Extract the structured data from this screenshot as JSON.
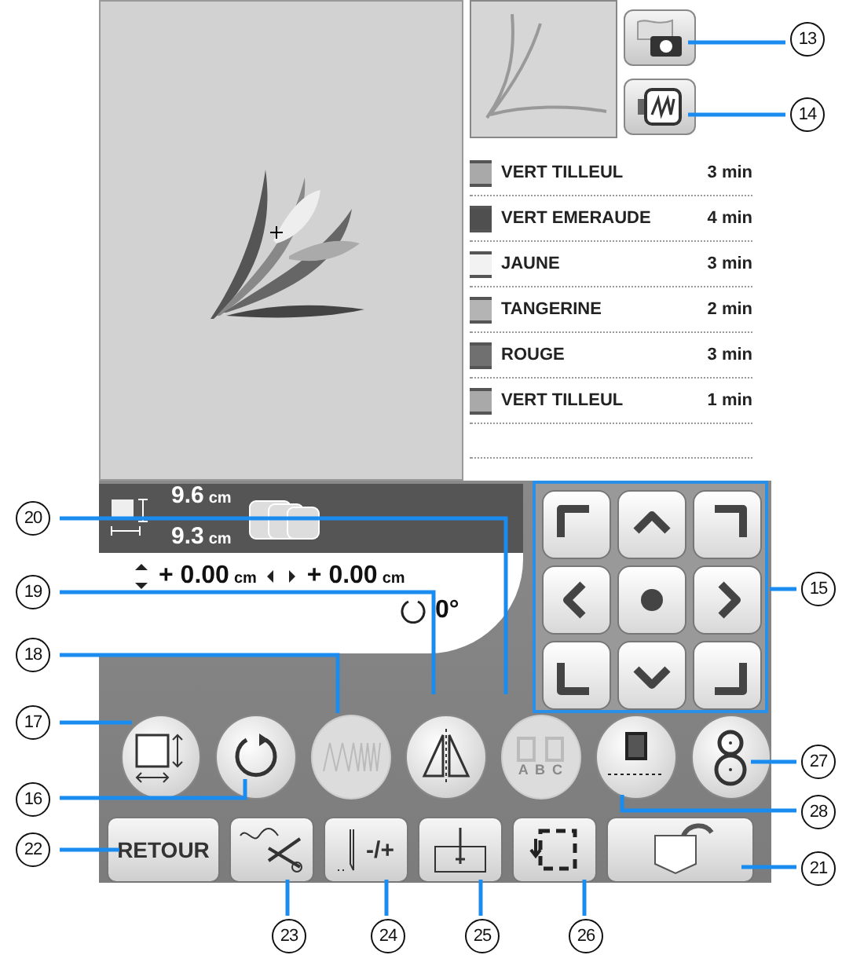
{
  "side_buttons": [
    {
      "kind": "camera"
    },
    {
      "kind": "hoop"
    }
  ],
  "threads": [
    {
      "name": "VERT TILLEUL",
      "time": "3 min",
      "color": "#a9a9a9"
    },
    {
      "name": "VERT EMERAUDE",
      "time": "4 min",
      "color": "#4f4f4f"
    },
    {
      "name": "JAUNE",
      "time": "3 min",
      "color": "#f2f2f2"
    },
    {
      "name": "TANGERINE",
      "time": "2 min",
      "color": "#b4b4b4"
    },
    {
      "name": "ROUGE",
      "time": "3 min",
      "color": "#707070"
    },
    {
      "name": "VERT TILLEUL",
      "time": "1 min",
      "color": "#a9a9a9"
    }
  ],
  "size": {
    "height": {
      "value": "9.6",
      "unit": "cm"
    },
    "width": {
      "value": "9.3",
      "unit": "cm"
    }
  },
  "offsets": {
    "vertical": {
      "sign": "+",
      "value": "0.00",
      "unit": "cm"
    },
    "horizontal": {
      "sign": "+",
      "value": "0.00",
      "unit": "cm"
    },
    "rotation": "0°"
  },
  "edit_buttons": [
    {
      "kind": "size",
      "disabled": false
    },
    {
      "kind": "rotate",
      "disabled": false
    },
    {
      "kind": "density",
      "disabled": true
    },
    {
      "kind": "mirror",
      "disabled": false
    },
    {
      "kind": "color",
      "disabled": true,
      "label": "A B C"
    },
    {
      "kind": "thread_mark",
      "disabled": false
    },
    {
      "kind": "figure8",
      "disabled": false
    }
  ],
  "bottom_buttons": [
    {
      "kind": "text",
      "label": "RETOUR"
    },
    {
      "kind": "trim"
    },
    {
      "kind": "needle",
      "label": "-/+"
    },
    {
      "kind": "needle_position"
    },
    {
      "kind": "trial"
    },
    {
      "kind": "pocket"
    }
  ],
  "callouts": [
    "13",
    "14",
    "20",
    "15",
    "19",
    "18",
    "17",
    "27",
    "16",
    "28",
    "22",
    "21",
    "23",
    "24",
    "25",
    "26"
  ]
}
